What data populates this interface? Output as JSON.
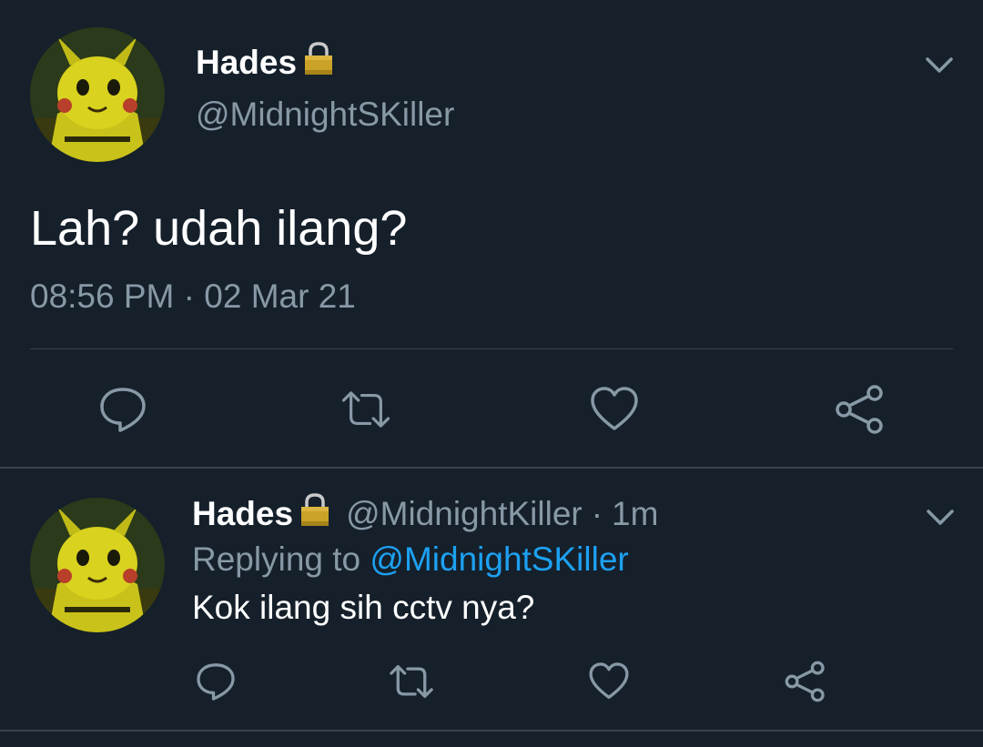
{
  "main_tweet": {
    "display_name": "Hades",
    "handle": "@MidnightSKiller",
    "text": "Lah? udah ilang?",
    "time": "08:56 PM",
    "separator": "·",
    "date": "02 Mar 21",
    "icons": {
      "lock": "lock-icon",
      "menu": "chevron-down-icon",
      "reply": "comment-icon",
      "retweet": "retweet-icon",
      "like": "heart-icon",
      "share": "share-icon"
    }
  },
  "reply_tweet": {
    "display_name": "Hades",
    "handle": "@MidnightKiller",
    "separator": "·",
    "time": "1m",
    "replying_label": "Replying to",
    "replying_to": "@MidnightSKiller",
    "text": "Kok ilang sih cctv nya?"
  },
  "colors": {
    "background": "#15202b",
    "primary_text": "#ffffff",
    "secondary_text": "#8899a6",
    "link": "#1da1f2",
    "divider": "#38444d",
    "lock": "#c9a227"
  }
}
